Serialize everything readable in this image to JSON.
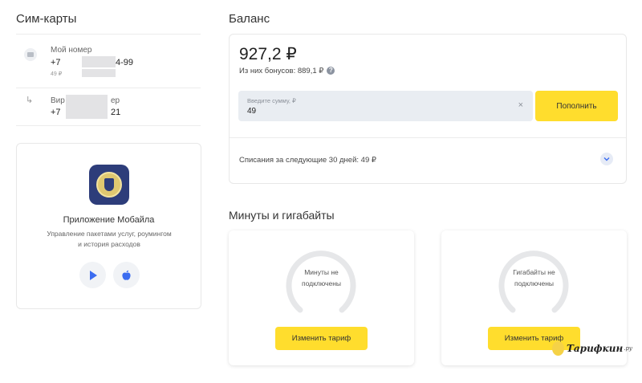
{
  "sims": {
    "title": "Сим-карты",
    "main": {
      "label": "Мой номер",
      "phone_prefix": "+7",
      "phone_suffix": "4-99",
      "sub": "49 ₽"
    },
    "virtual": {
      "label_start": "Вир",
      "label_end": "ер",
      "phone_prefix": "+7",
      "phone_suffix": "21"
    }
  },
  "app": {
    "title": "Приложение Мобайла",
    "desc_line1": "Управление пакетами услуг, роумингом",
    "desc_line2": "и история расходов"
  },
  "balance": {
    "title": "Баланс",
    "amount": "927,2 ₽",
    "bonus": "Из них бонусов: 889,1 ₽",
    "help": "?",
    "input_placeholder": "Введите сумму, ₽",
    "input_value": "49",
    "clear": "×",
    "topup_label": "Пополнить",
    "charges": "Списания за следующие 30 дней: 49 ₽"
  },
  "packages": {
    "title": "Минуты и гигабайты",
    "cards": [
      {
        "line1": "Минуты не",
        "line2": "подключены",
        "button": "Изменить тариф"
      },
      {
        "line1": "Гигабайты не",
        "line2": "подключены",
        "button": "Изменить тариф"
      }
    ]
  },
  "watermark": {
    "text": "Тарифкин",
    "suffix": ".ру"
  },
  "colors": {
    "accent": "#ffdd2d",
    "input_bg": "#e9edf2",
    "ring": "#e6e7e9"
  }
}
